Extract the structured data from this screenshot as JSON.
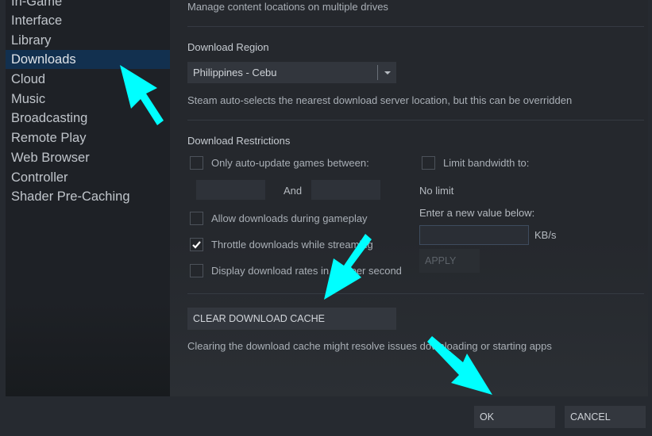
{
  "sidebar": {
    "items": [
      {
        "label": "In-Game",
        "active": false
      },
      {
        "label": "Interface",
        "active": false
      },
      {
        "label": "Library",
        "active": false
      },
      {
        "label": "Downloads",
        "active": true
      },
      {
        "label": "Cloud",
        "active": false
      },
      {
        "label": "Music",
        "active": false
      },
      {
        "label": "Broadcasting",
        "active": false
      },
      {
        "label": "Remote Play",
        "active": false
      },
      {
        "label": "Web Browser",
        "active": false
      },
      {
        "label": "Controller",
        "active": false
      },
      {
        "label": "Shader Pre-Caching",
        "active": false
      }
    ]
  },
  "content_libraries": {
    "description": "Manage content locations on multiple drives"
  },
  "download_region": {
    "heading": "Download Region",
    "selected": "Philippines - Cebu",
    "description": "Steam auto-selects the nearest download server location, but this can be overridden"
  },
  "download_restrictions": {
    "heading": "Download Restrictions",
    "auto_update": {
      "label": "Only auto-update games between:",
      "checked": false,
      "and_label": "And",
      "start_value": "",
      "end_value": ""
    },
    "allow_during_gameplay": {
      "label": "Allow downloads during gameplay",
      "checked": false
    },
    "throttle_streaming": {
      "label": "Throttle downloads while streaming",
      "checked": true
    },
    "display_bits": {
      "label": "Display download rates in bits per second",
      "checked": false
    },
    "limit_bandwidth": {
      "label": "Limit bandwidth to:",
      "checked": false
    },
    "current_limit": "No limit",
    "enter_value_label": "Enter a new value below:",
    "bandwidth_value": "",
    "unit": "KB/s",
    "apply_label": "APPLY"
  },
  "cache": {
    "button_label": "CLEAR DOWNLOAD CACHE",
    "description": "Clearing the download cache might resolve issues downloading or starting apps"
  },
  "footer": {
    "ok_label": "OK",
    "cancel_label": "CANCEL"
  },
  "annotations": {
    "arrow_color": "#00ffff"
  }
}
